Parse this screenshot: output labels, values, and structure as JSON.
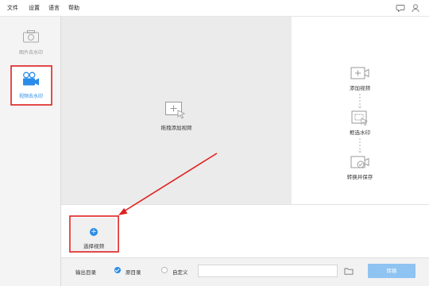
{
  "menu": {
    "items": [
      "文件",
      "设置",
      "语言",
      "帮助"
    ]
  },
  "topbar": {
    "icons": [
      "chat-icon",
      "user-icon"
    ]
  },
  "sidebar": {
    "items": [
      {
        "label": "图片去水印",
        "icon": "photo-camera-icon",
        "active": false
      },
      {
        "label": "视频去水印",
        "icon": "video-camera-icon",
        "active": true
      }
    ]
  },
  "main": {
    "drop_label": "拖拽添加视频",
    "steps": [
      {
        "label": "添加视频",
        "icon": "add-video-icon"
      },
      {
        "label": "框选水印",
        "icon": "select-area-icon"
      },
      {
        "label": "转换并保存",
        "icon": "convert-save-icon"
      }
    ]
  },
  "strip": {
    "select_label": "选择视频",
    "plus": "+"
  },
  "footer": {
    "output_label": "输出目录",
    "option_original": "原目录",
    "option_custom": "自定义",
    "selected": "原目录",
    "path_value": "",
    "convert_label": "转换"
  },
  "colors": {
    "accent": "#2a8ce8",
    "annotation": "#e02020",
    "convert_button": "#8ec3f2"
  }
}
